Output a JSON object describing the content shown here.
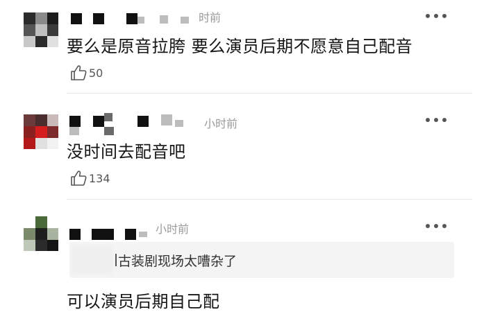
{
  "comments": [
    {
      "time": "时前",
      "text": "要么是原音拉胯 要么演员后期不愿意自己配音",
      "likes": "50"
    },
    {
      "time": "小时前",
      "text": "没时间去配音吧",
      "likes": "134"
    },
    {
      "time": "小时前",
      "quote": "古装剧现场太嘈杂了",
      "text": "可以演员后期自己配"
    }
  ],
  "icons": {
    "like": "thumbs-up-icon",
    "more": "more-dots-icon"
  },
  "colors": {
    "text": "#151515",
    "meta": "#9a9a9a",
    "divider": "#e6e6e6",
    "quote_bg": "#f4f4f4"
  }
}
